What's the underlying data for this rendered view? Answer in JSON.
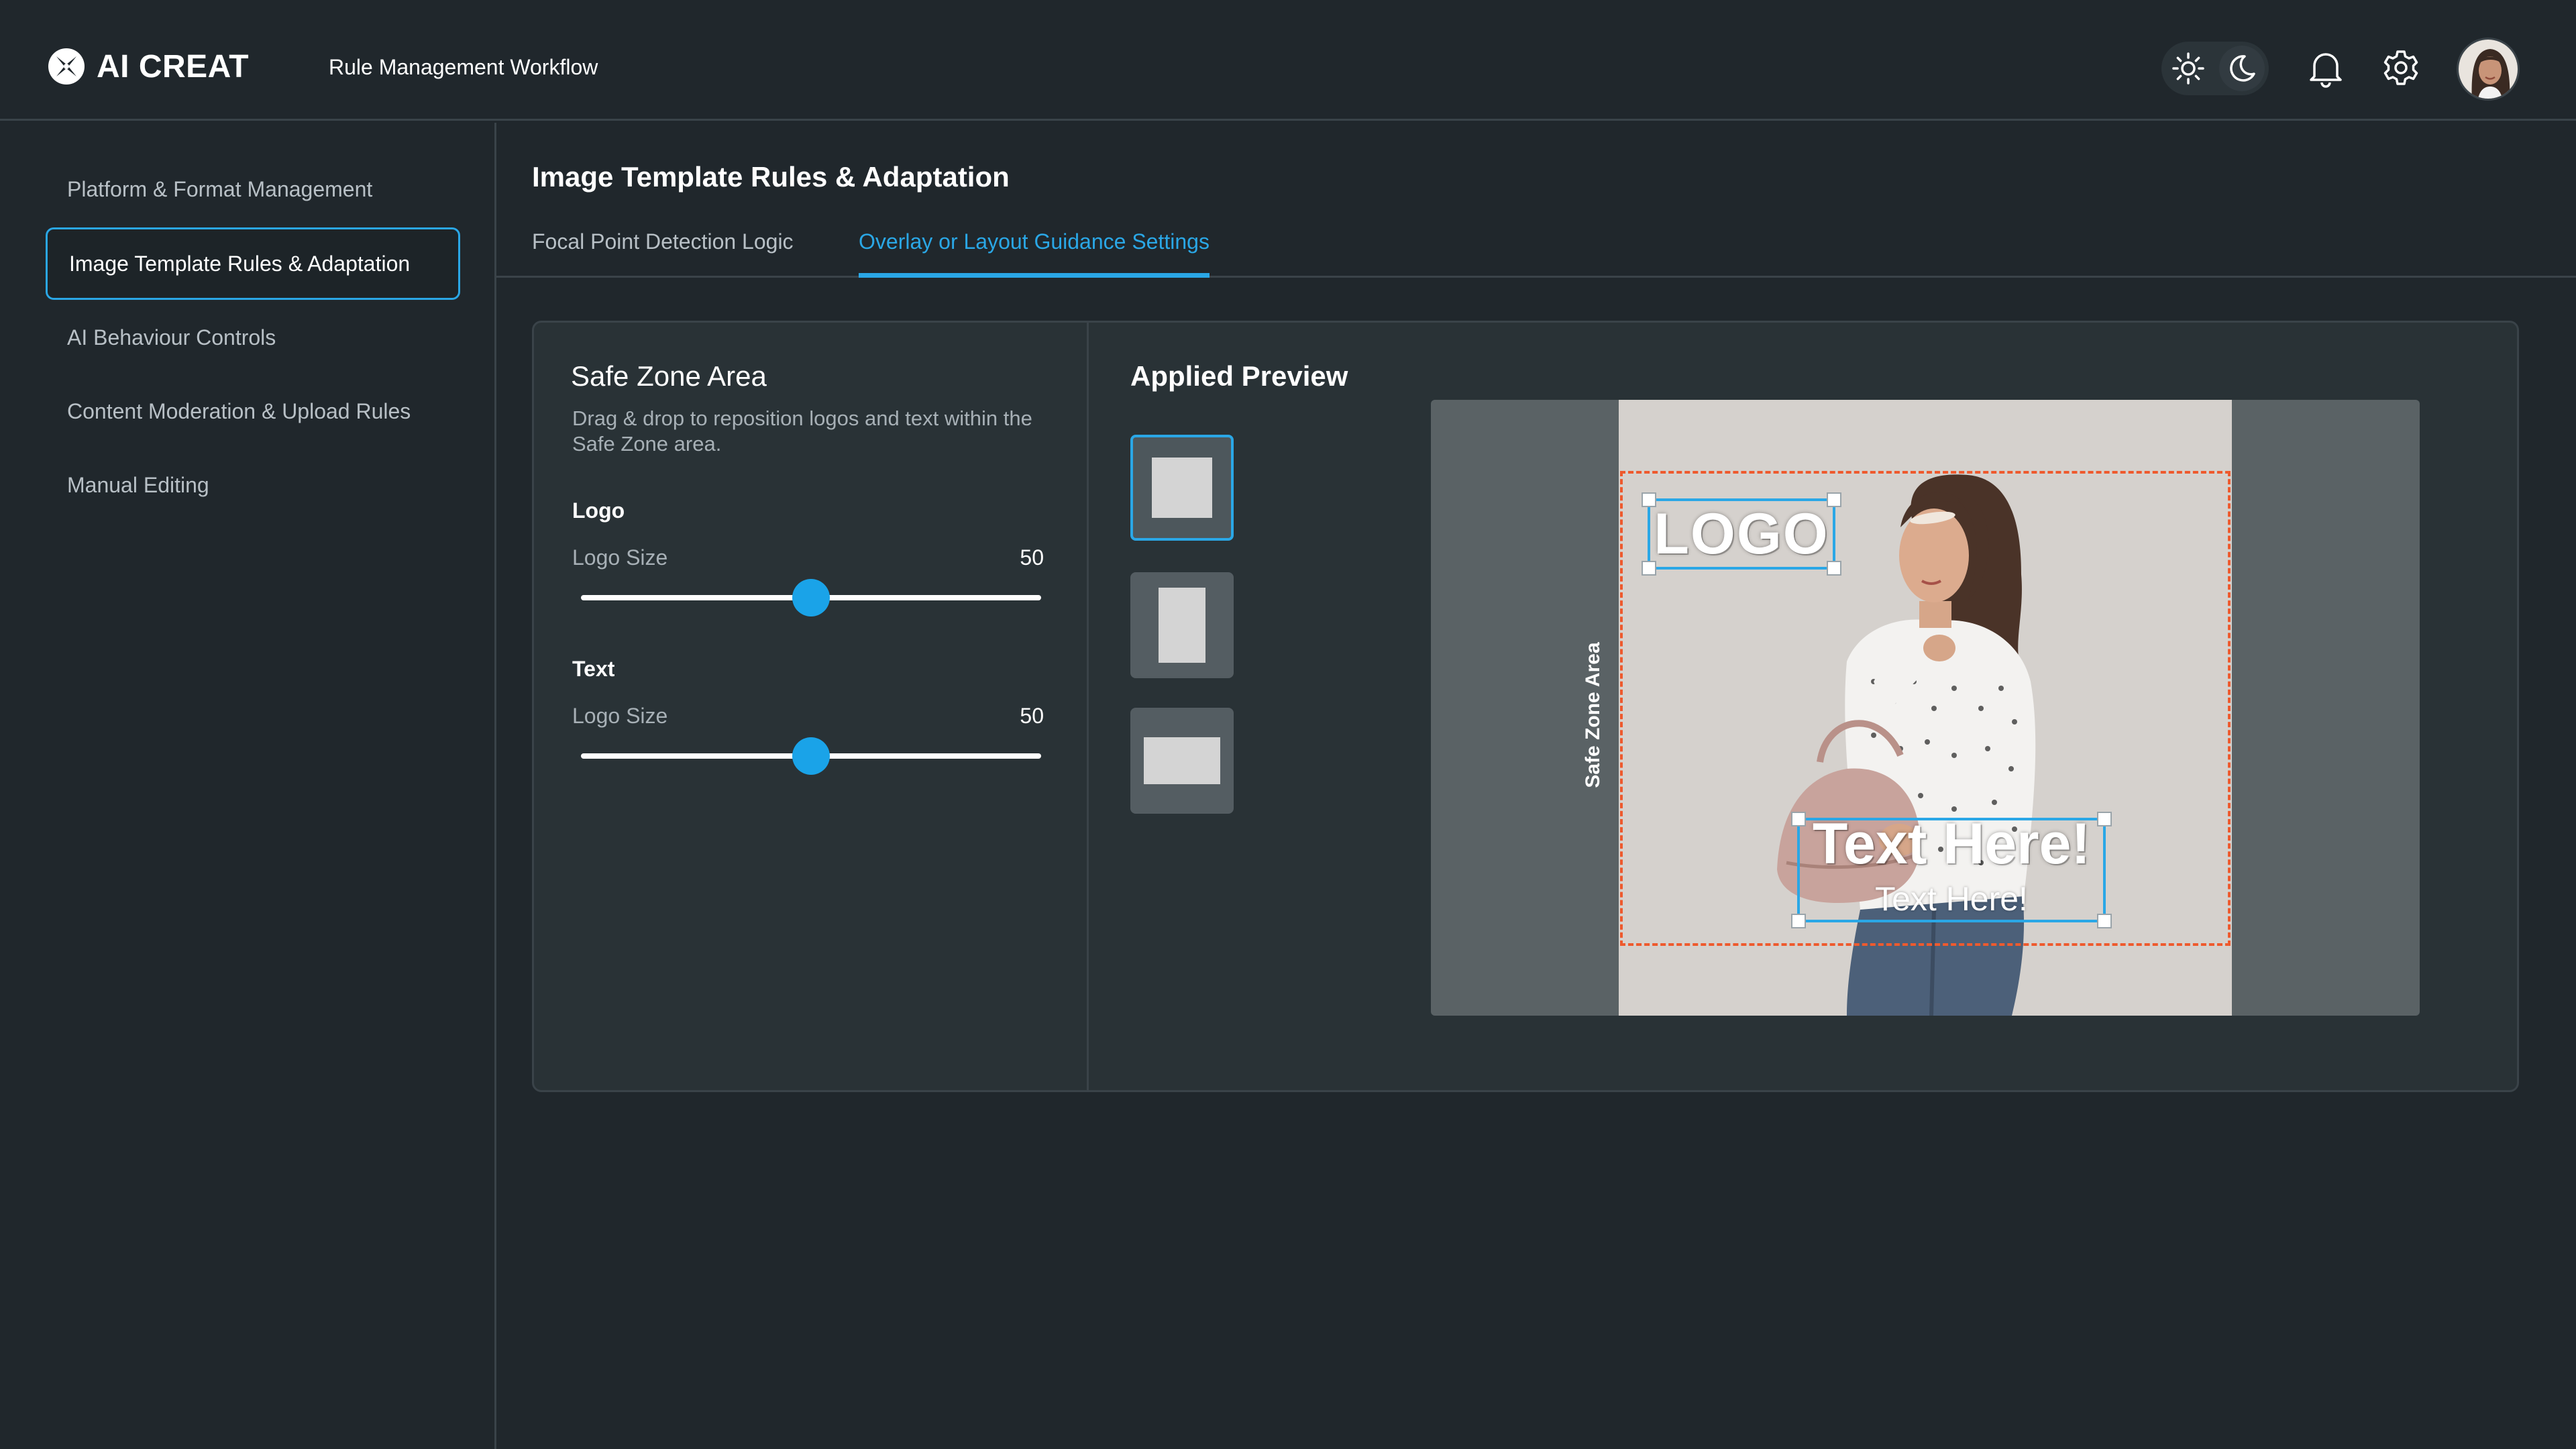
{
  "app": {
    "brand": "AI CREAT",
    "header_title": "Rule Management Workflow",
    "icons": [
      "sun-icon",
      "moon-icon",
      "bell-icon",
      "gear-icon"
    ]
  },
  "sidebar": {
    "items": [
      {
        "label": "Platform & Format Management",
        "active": false
      },
      {
        "label": "Image Template Rules & Adaptation",
        "active": true
      },
      {
        "label": "AI Behaviour Controls",
        "active": false
      },
      {
        "label": "Content Moderation & Upload Rules",
        "active": false
      },
      {
        "label": "Manual Editing",
        "active": false
      }
    ]
  },
  "main": {
    "title": "Image Template Rules & Adaptation",
    "tabs": [
      {
        "label": "Focal Point Detection Logic",
        "active": false
      },
      {
        "label": "Overlay or Layout Guidance Settings",
        "active": true
      }
    ]
  },
  "safe_zone": {
    "title": "Safe Zone Area",
    "description": "Drag & drop to reposition logos and text within the Safe Zone area.",
    "logo": {
      "group_label": "Logo",
      "slider_label": "Logo Size",
      "value": "50",
      "fraction": 0.5
    },
    "text": {
      "group_label": "Text",
      "slider_label": "Logo Size",
      "value": "50",
      "fraction": 0.5
    }
  },
  "preview": {
    "title": "Applied Preview",
    "formats": [
      "square",
      "portrait",
      "landscape"
    ],
    "selected_format": "square",
    "safe_zone_label": "Safe Zone Area",
    "logo_text": "LOGO",
    "headline": "Text Here!",
    "subline": "Text Here!"
  },
  "colors": {
    "background": "#20272c",
    "panel": "#293236",
    "accent": "#2aa7e6",
    "safe_zone_border": "#ee5a2e"
  }
}
